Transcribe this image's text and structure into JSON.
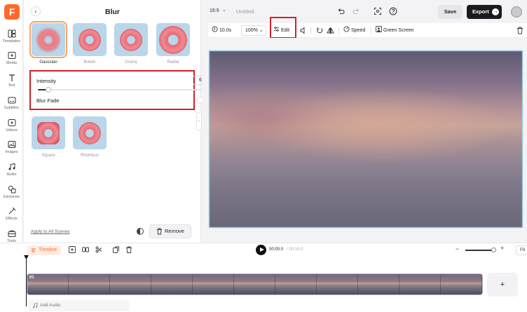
{
  "app": {
    "logo_letter": "F"
  },
  "rail": [
    {
      "label": "Templates",
      "icon": "templates-icon"
    },
    {
      "label": "Media",
      "icon": "media-icon"
    },
    {
      "label": "Text",
      "icon": "text-icon"
    },
    {
      "label": "Subtitles",
      "icon": "subtitles-icon"
    },
    {
      "label": "Videos",
      "icon": "videos-icon"
    },
    {
      "label": "Images",
      "icon": "images-icon"
    },
    {
      "label": "Audio",
      "icon": "audio-icon"
    },
    {
      "label": "Elements",
      "icon": "elements-icon"
    },
    {
      "label": "Effects",
      "icon": "effects-icon"
    },
    {
      "label": "Tools",
      "icon": "tools-icon"
    }
  ],
  "panel": {
    "title": "Blur",
    "effects": [
      {
        "label": "Gaussian",
        "selected": true
      },
      {
        "label": "Bokeh",
        "selected": false
      },
      {
        "label": "Grainy",
        "selected": false
      },
      {
        "label": "Radial",
        "selected": false
      },
      {
        "label": "Square",
        "selected": false
      },
      {
        "label": "Rhombus",
        "selected": false
      }
    ],
    "intensity_label": "Intensity",
    "intensity_value": "6",
    "intensity_fraction": 0.06,
    "blur_fade_label": "Blur Fade",
    "blur_fade_on": false,
    "apply_all": "Apply to All Scenes",
    "remove_label": "Remove"
  },
  "topbar": {
    "ratio": "16:9",
    "title": "Untitled",
    "save": "Save",
    "export": "Export"
  },
  "toolbar": {
    "duration": "10.0s",
    "zoom": "100%",
    "edit": "Edit",
    "speed": "Speed",
    "green_screen": "Green Screen"
  },
  "timeline": {
    "tab": "Timeline",
    "current_time": "00:00.0",
    "total_time": "/ 00:10.0",
    "fit": "Fit",
    "zoom_fraction": 0.9,
    "clip_label": "01",
    "add_audio": "Add Audio",
    "add_clip": "+"
  },
  "colors": {
    "accent": "#ff6a2b",
    "highlight_red": "#d4202a",
    "canvas_border": "#7ed6e6"
  }
}
